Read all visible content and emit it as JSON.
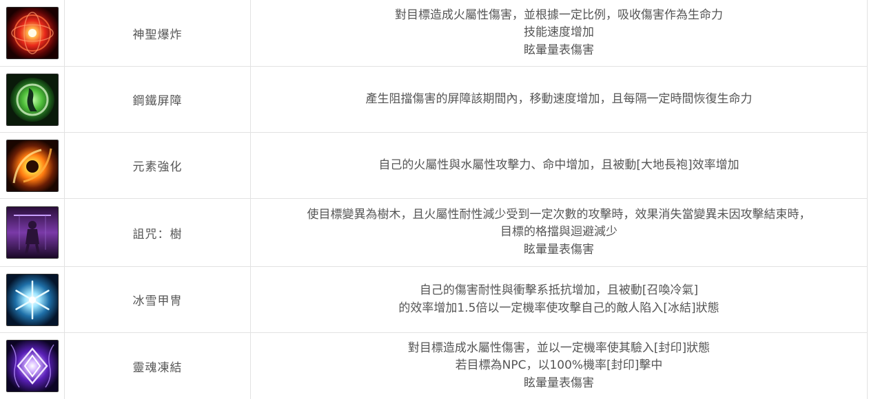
{
  "skills": [
    {
      "icon": "fire-orb-icon",
      "name": "神聖爆炸",
      "lines": [
        "對目標造成火屬性傷害，並根據一定比例，吸收傷害作為生命力",
        "技能速度增加",
        "眩暈量表傷害"
      ]
    },
    {
      "icon": "green-barrier-icon",
      "name": "鋼鐵屏障",
      "lines": [
        "產生阻擋傷害的屏障該期間內，移動速度增加，且每隔一定時間恢復生命力"
      ]
    },
    {
      "icon": "elemental-swirl-icon",
      "name": "元素強化",
      "lines": [
        "自己的火屬性與水屬性攻擊力、命中增加，且被動[大地長袍]效率增加"
      ]
    },
    {
      "icon": "purple-curse-tree-icon",
      "name": "詛咒：樹",
      "lines": [
        "使目標變異為樹木，且火屬性耐性減少受到一定次數的攻擊時，效果消失當變異未因攻擊結束時，",
        "目標的格擋與迴避減少",
        "眩暈量表傷害"
      ]
    },
    {
      "icon": "ice-snowflake-icon",
      "name": "冰雪甲冑",
      "lines": [
        "自己的傷害耐性與衝擊系抵抗增加，且被動[召喚冷氣]",
        "的效率增加1.5倍以一定機率使攻擊自己的敵人陷入[冰結]狀態"
      ]
    },
    {
      "icon": "violet-seal-icon",
      "name": "靈魂凍結",
      "lines": [
        "對目標造成水屬性傷害，並以一定機率使其驗入[封印]狀態",
        "若目標為NPC，以100%機率[封印]擊中",
        "眩暈量表傷害"
      ]
    }
  ]
}
